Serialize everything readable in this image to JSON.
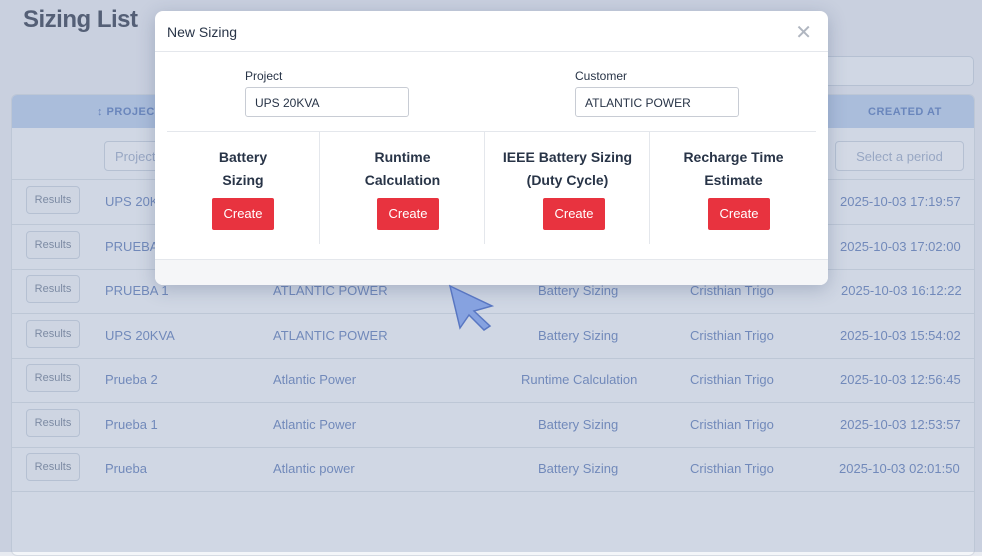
{
  "page": {
    "title": "Sizing List"
  },
  "table": {
    "headers": {
      "project": "↕ PROJECT",
      "created_at": "CREATED AT"
    },
    "filters": {
      "project_placeholder": "Project",
      "period_placeholder": "Select a period"
    },
    "result_label": "Results",
    "rows": [
      {
        "project": "UPS 20K",
        "customer": "",
        "type": "",
        "user": "",
        "created": "2025-10-03 17:19:57"
      },
      {
        "project": "PRUEBA",
        "customer": "",
        "type": "",
        "user": "",
        "created": "2025-10-03 17:02:00"
      },
      {
        "project": "PRUEBA 1",
        "customer": "ATLANTIC POWER",
        "type": "Battery Sizing",
        "user": "Cristhian Trigo",
        "created": "2025-10-03 16:12:22"
      },
      {
        "project": "UPS 20KVA",
        "customer": "ATLANTIC POWER",
        "type": "Battery Sizing",
        "user": "Cristhian Trigo",
        "created": "2025-10-03 15:54:02"
      },
      {
        "project": "Prueba 2",
        "customer": "Atlantic Power",
        "type": "Runtime Calculation",
        "user": "Cristhian Trigo",
        "created": "2025-10-03 12:56:45"
      },
      {
        "project": "Prueba 1",
        "customer": "Atlantic Power",
        "type": "Battery Sizing",
        "user": "Cristhian Trigo",
        "created": "2025-10-03 12:53:57"
      },
      {
        "project": "Prueba",
        "customer": "Atlantic power",
        "type": "Battery Sizing",
        "user": "Cristhian Trigo",
        "created": "2025-10-03 02:01:50"
      }
    ]
  },
  "modal": {
    "title": "New Sizing",
    "close": "✕",
    "project_label": "Project",
    "project_value": "UPS 20KVA",
    "customer_label": "Customer",
    "customer_value": "ATLANTIC POWER",
    "options": [
      {
        "line1": "Battery",
        "line2": "Sizing",
        "button": "Create"
      },
      {
        "line1": "Runtime",
        "line2": "Calculation",
        "button": "Create"
      },
      {
        "line1": "IEEE Battery Sizing",
        "line2": "(Duty Cycle)",
        "button": "Create"
      },
      {
        "line1": "Recharge Time",
        "line2": "Estimate",
        "button": "Create"
      }
    ]
  },
  "colors": {
    "accent": "#e8333f",
    "header_bg": "#b7cbea",
    "cursor": "#7f9de0"
  },
  "icons": {
    "cursor": "mouse-pointer-icon",
    "close": "close-icon"
  }
}
